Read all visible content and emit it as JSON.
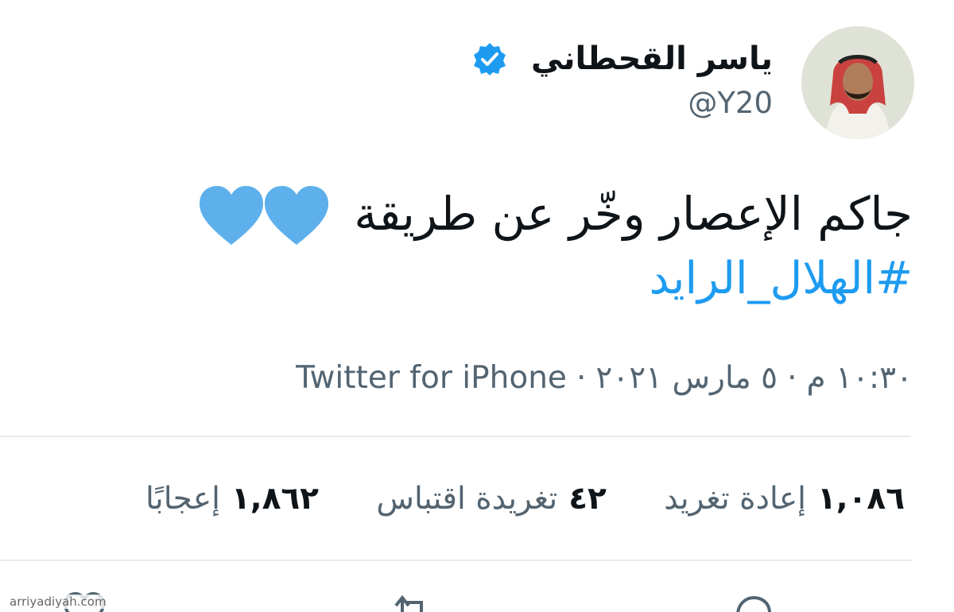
{
  "author": {
    "display_name": "ياسر القحطاني",
    "handle": "@Y20",
    "verified": true,
    "avatar_icon": "profile-photo"
  },
  "tweet": {
    "text": "جاكم الإعصار وخّر عن طريقة",
    "emoji_icons": [
      "blue-heart-icon",
      "blue-heart-icon"
    ],
    "hashtag": "#الهلال_الرايد"
  },
  "meta": {
    "time": "١٠:٣٠ م",
    "separator": "·",
    "date": "٥ مارس ٢٠٢١",
    "source": "Twitter for iPhone"
  },
  "stats": {
    "retweets_value": "١,٠٨٦",
    "retweets_label": "إعادة تغريد",
    "quotes_value": "٤٢",
    "quotes_label": "تغريدة اقتباس",
    "likes_value": "١,٨٦٢",
    "likes_label": "إعجابًا"
  },
  "actions": {
    "icons": [
      "reply-icon",
      "retweet-icon",
      "like-icon"
    ]
  },
  "watermark": "arriyadiyah.com",
  "colors": {
    "accent": "#1d9bf0",
    "text_primary": "#0f1419",
    "text_secondary": "#536471",
    "divider": "#e6ecf0"
  }
}
